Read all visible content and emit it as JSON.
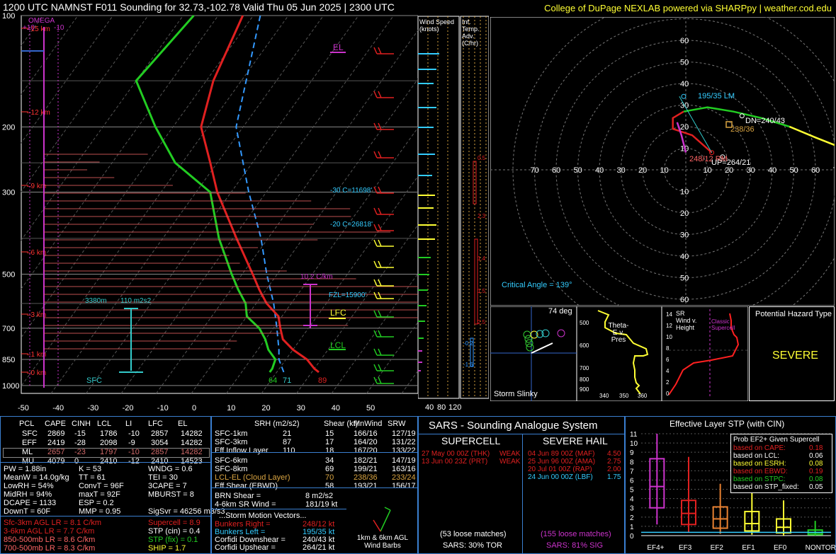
{
  "header": {
    "title": "1200 UTC NAMNST F011 Sounding for 32.73,-102.78 Valid  Thu 05 Jun 2025 | 2300 UTC",
    "credit": "College of DuPage NEXLAB powered via SHARPpy | weather.cod.edu"
  },
  "skewt": {
    "pressure_ticks": [
      "100",
      "200",
      "300",
      "500",
      "700",
      "850",
      "1000"
    ],
    "temp_ticks": [
      "-50",
      "-40",
      "-30",
      "-20",
      "-10",
      "0",
      "10",
      "20",
      "30",
      "40",
      "50"
    ],
    "height_labels": [
      "15 km",
      "12 km",
      "9 km",
      "6 km",
      "3 km",
      "1 km",
      "0 km"
    ],
    "annotations": {
      "omega": "OMEGA",
      "omega_ticks": [
        "+10",
        "-10"
      ],
      "el": "EL",
      "lfc": "LFC",
      "lcl": "LCL",
      "sfc": "SFC",
      "minus30": "-30 C=11698'",
      "minus20": "-20 C=26818'",
      "fzl": "FZL=15900'",
      "lapse": "10.2 C/km",
      "eff_layer": "3380m",
      "eff_srh": "110 m2s2",
      "t_sfc": "89",
      "td_sfc": "64",
      "tw_sfc": "71"
    },
    "temperature": [
      [
        100,
        -63
      ],
      [
        150,
        -58
      ],
      [
        200,
        -52
      ],
      [
        250,
        -42
      ],
      [
        300,
        -34
      ],
      [
        400,
        -19
      ],
      [
        500,
        -7
      ],
      [
        550,
        -2
      ],
      [
        600,
        3
      ],
      [
        650,
        9
      ],
      [
        700,
        12
      ],
      [
        750,
        15
      ],
      [
        800,
        20
      ],
      [
        850,
        26
      ],
      [
        900,
        30
      ],
      [
        920,
        32
      ]
    ],
    "dewpoint": [
      [
        100,
        -77
      ],
      [
        150,
        -80
      ],
      [
        200,
        -65
      ],
      [
        250,
        -52
      ],
      [
        300,
        -36
      ],
      [
        400,
        -24
      ],
      [
        500,
        -13
      ],
      [
        550,
        -8
      ],
      [
        600,
        -3
      ],
      [
        650,
        0
      ],
      [
        700,
        6
      ],
      [
        750,
        10
      ],
      [
        800,
        13
      ],
      [
        850,
        17
      ],
      [
        900,
        18
      ],
      [
        920,
        18
      ]
    ],
    "parcel": [
      [
        100,
        -58
      ],
      [
        200,
        -42
      ],
      [
        300,
        -25
      ],
      [
        400,
        -12
      ],
      [
        500,
        -3
      ],
      [
        600,
        5
      ],
      [
        700,
        11
      ],
      [
        800,
        16
      ],
      [
        850,
        18
      ],
      [
        920,
        22
      ]
    ],
    "wind_speed_header": "Wind Speed (knots)",
    "wind_speed_ticks": [
      "40",
      "80",
      "120"
    ],
    "inf_temp_header": "Inf. Temp. Adv. (C/hr)",
    "inf_temp_values": [
      "0.5",
      "2.3",
      "1.4",
      "1.5",
      "2.5",
      "-0.2",
      "-1.6"
    ]
  },
  "hodograph": {
    "x_ticks": [
      "70",
      "60",
      "50",
      "40",
      "30",
      "20",
      "10",
      "10",
      "20",
      "30",
      "40",
      "50",
      "60",
      "70",
      "80"
    ],
    "y_ticks": [
      "60",
      "50",
      "40",
      "30",
      "20",
      "10",
      "10",
      "20",
      "30",
      "40",
      "50",
      "60"
    ],
    "labels": {
      "lm": "195/35 LM",
      "dn": "DN=240/43",
      "mean": "238/36",
      "rm": "248/12 RM",
      "up": "UP=264/21",
      "crit": "Critical Angle = 139°"
    }
  },
  "slinky": {
    "title": "Storm Slinky",
    "angle": "74 deg"
  },
  "thetae": {
    "title": "Theta-E v. Pres",
    "p_ticks": [
      "500",
      "600",
      "700",
      "800",
      "900"
    ],
    "x_ticks": [
      "340",
      "350",
      "360"
    ]
  },
  "srwind": {
    "title": "SR Wind v. Height",
    "label": "Classic Supercell",
    "h_ticks": [
      "14",
      "12",
      "10",
      "8",
      "6",
      "4",
      "2",
      "0"
    ]
  },
  "hazard": {
    "title": "Potential Hazard Type",
    "value": "SEVERE"
  },
  "parcels": {
    "headers": [
      "PCL",
      "CAPE",
      "CINH",
      "LCL",
      "LI",
      "LFC",
      "EL"
    ],
    "rows": [
      [
        "SFC",
        "2869",
        "-15",
        "1786",
        "-10",
        "2857",
        "14282"
      ],
      [
        "EFF",
        "2419",
        "-28",
        "2098",
        "-9",
        "3054",
        "14282"
      ],
      [
        "ML",
        "2657",
        "-23",
        "1797",
        "-10",
        "2857",
        "14282"
      ],
      [
        "MU",
        "4079",
        "0",
        "2410",
        "-12",
        "2410",
        "14523"
      ]
    ]
  },
  "indices": {
    "col1": [
      "PW = 1.88in",
      "MeanW = 14.0g/kg",
      "LowRH = 54%",
      "MidRH = 94%",
      "DCAPE = 1133",
      "DownT = 60F"
    ],
    "col2": [
      "K = 53",
      "TT = 61",
      "ConvT = 96F",
      "maxT = 92F",
      "ESP = 0.2",
      "MMP = 0.95"
    ],
    "col3": [
      "WNDG = 0.6",
      "TEI = 30",
      "3CAPE = 7",
      "MBURST = 8",
      "",
      ""
    ],
    "sigsvr": "SigSvr = 46256 m3/s3",
    "lapse": [
      "Sfc-3km AGL LR = 8.1 C/km",
      "3-6km AGL LR = 7.7 C/km",
      "850-500mb LR = 8.6 C/km",
      "700-500mb LR = 8.3 C/km"
    ],
    "comp": [
      "Supercell = 8.9",
      "STP (cin) = 0.4",
      "STP (fix) = 0.1",
      "SHIP = 1.7"
    ]
  },
  "kinematics": {
    "headers": [
      "SRH (m2/s2)",
      "Shear (kt)",
      "MnWind",
      "SRW"
    ],
    "rows1": [
      [
        "SFC-1km",
        "21",
        "15",
        "166/16",
        "127/19"
      ],
      [
        "SFC-3km",
        "87",
        "17",
        "164/20",
        "131/22"
      ],
      [
        "Eff Inflow Layer",
        "110",
        "18",
        "167/20",
        "133/22"
      ]
    ],
    "rows2": [
      [
        "SFC-6km",
        "34",
        "182/21",
        "147/19"
      ],
      [
        "SFC-8km",
        "69",
        "199/21",
        "163/16"
      ],
      [
        "LCL-EL (Cloud Layer)",
        "70",
        "238/36",
        "233/24"
      ],
      [
        "Eff Shear (EBWD)",
        "58",
        "193/21",
        "156/17"
      ]
    ],
    "brn": [
      "BRN Shear =",
      "8 m2/s2"
    ],
    "srw46": [
      "4-6km SR Wind =",
      "181/19 kt"
    ],
    "storm_title": "...Storm Motion Vectors...",
    "storm": [
      [
        "Bunkers Right =",
        "248/12 kt"
      ],
      [
        "Bunkers Left =",
        "195/35 kt"
      ],
      [
        "Corfidi Downshear =",
        "240/43 kt"
      ],
      [
        "Corfidi Upshear =",
        "264/21 kt"
      ]
    ],
    "barbs_label": "1km & 6km AGL Wind Barbs"
  },
  "sars": {
    "title": "SARS - Sounding Analogue System",
    "supercell": "SUPERCELL",
    "hail": "SEVERE HAIL",
    "sc_matches": [
      [
        "27 May 00 00Z (THK)",
        "WEAK"
      ],
      [
        "13 Jun 00 23Z (PRT)",
        "WEAK"
      ]
    ],
    "hail_matches": [
      [
        "04 Jun 89 00Z (MAF)",
        "4.50"
      ],
      [
        "25 Jun 96 00Z (AMA)",
        "2.75"
      ],
      [
        "20 Jul 01 00Z (RAP)",
        "2.00"
      ],
      [
        "24 Jun 00 00Z (LBF)",
        "1.75"
      ]
    ],
    "sc_loose": "(53 loose matches)",
    "hail_loose": "(155 loose matches)",
    "sc_sars": "SARS: 30% TOR",
    "hail_sars": "SARS: 81% SIG"
  },
  "stp": {
    "title": "Effective Layer STP (with CIN)",
    "y_ticks": [
      "11",
      "10",
      "9",
      "8",
      "7",
      "6",
      "5",
      "4",
      "3",
      "2",
      "1",
      "0"
    ],
    "categories": [
      "EF4+",
      "EF3",
      "EF2",
      "EF1",
      "EF0",
      "NONTOR"
    ],
    "prob_title": "Prob EF2+ Given Supercell",
    "probs": [
      [
        "based on CAPE:",
        "0.18"
      ],
      [
        "based on LCL:",
        "0.06"
      ],
      [
        "based on ESRH:",
        "0.08"
      ],
      [
        "based on EBWD:",
        "0.19"
      ],
      [
        "based on STPC:",
        "0.08"
      ],
      [
        "based on STP_fixed:",
        "0.05"
      ]
    ]
  },
  "chart_data": [
    {
      "type": "line",
      "title": "1200 UTC NAMNST F011 Sounding for 32.73,-102.78 Valid  Thu 05 Jun 2025 | 2300 UTC",
      "xlabel": "",
      "ylabel": "",
      "ylim": [
        1000,
        100
      ],
      "xlim": [
        -50,
        50
      ],
      "scale": "log-pressure skew-T",
      "series": []
    },
    {
      "type": "box",
      "title": "Effective Layer STP (with CIN)",
      "categories": [
        "EF4+",
        "EF3",
        "EF2",
        "EF1",
        "EF0",
        "NONTOR"
      ],
      "ylim": [
        0,
        11
      ],
      "boxes": [
        {
          "min": 1.2,
          "q1": 3.0,
          "median": 5.3,
          "q3": 8.3,
          "max": 11.0
        },
        {
          "min": 0.4,
          "q1": 1.2,
          "median": 2.4,
          "q3": 3.8,
          "max": 8.5
        },
        {
          "min": 0.2,
          "q1": 0.8,
          "median": 1.8,
          "q3": 3.1,
          "max": 5.6
        },
        {
          "min": 0.1,
          "q1": 0.5,
          "median": 1.3,
          "q3": 2.6,
          "max": 5.0
        },
        {
          "min": 0.0,
          "q1": 0.3,
          "median": 0.9,
          "q3": 1.8,
          "max": 3.8
        },
        {
          "min": 0.0,
          "q1": 0.1,
          "median": 0.3,
          "q3": 0.6,
          "max": 1.6
        }
      ]
    }
  ]
}
